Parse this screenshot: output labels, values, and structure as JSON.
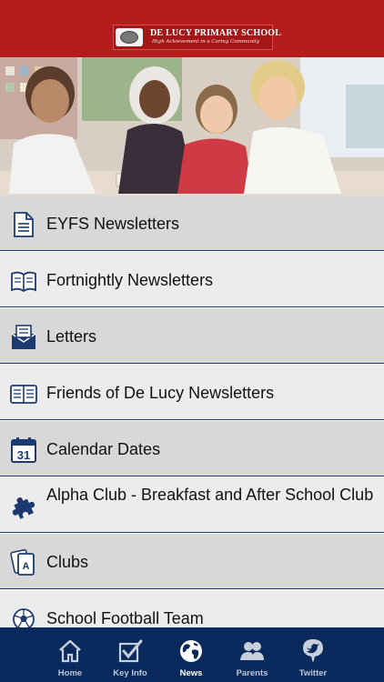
{
  "header": {
    "school_name": "DE LUCY PRIMARY SCHOOL",
    "tagline": "High Achievement in a Caring Community"
  },
  "menu": {
    "items": [
      {
        "label": "EYFS Newsletters",
        "icon": "document-icon"
      },
      {
        "label": "Fortnightly Newsletters",
        "icon": "open-book-icon"
      },
      {
        "label": "Letters",
        "icon": "envelope-icon"
      },
      {
        "label": "Friends of De Lucy Newsletters",
        "icon": "book-icon"
      },
      {
        "label": "Calendar Dates",
        "icon": "calendar-icon",
        "badge": "31"
      },
      {
        "label": "Alpha Club - Breakfast and After School Club",
        "icon": "puzzle-icon"
      },
      {
        "label": "Clubs",
        "icon": "playing-cards-icon",
        "badge": "A"
      },
      {
        "label": "School Football Team",
        "icon": "football-icon"
      }
    ]
  },
  "tabs": [
    {
      "label": "Home",
      "icon": "home-icon"
    },
    {
      "label": "Key Info",
      "icon": "checkbox-icon"
    },
    {
      "label": "News",
      "icon": "globe-icon",
      "active": true
    },
    {
      "label": "Parents",
      "icon": "people-icon"
    },
    {
      "label": "Twitter",
      "icon": "twitter-bird-icon"
    }
  ],
  "colors": {
    "header_red": "#b71c1c",
    "tabbar_navy": "#0a2a5e",
    "icon_navy": "#1d3a70",
    "row_dark": "#d8d8d8",
    "row_light": "#ececec"
  }
}
